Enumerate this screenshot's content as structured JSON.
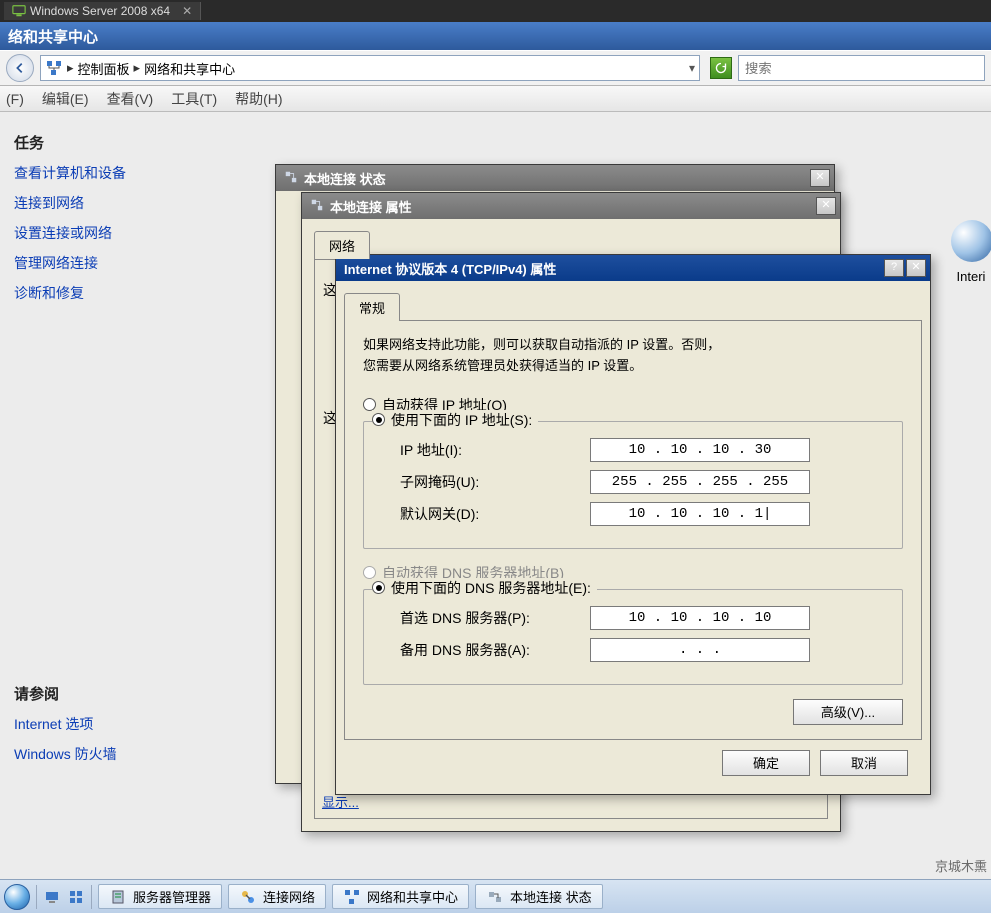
{
  "vm": {
    "tab_label": "Windows Server 2008 x64"
  },
  "window": {
    "title": "络和共享中心"
  },
  "addressbar": {
    "crumb1": "控制面板",
    "crumb2": "网络和共享中心",
    "search_placeholder": "搜索"
  },
  "menubar": {
    "file": "(F)",
    "edit": "编辑(E)",
    "view": "查看(V)",
    "tools": "工具(T)",
    "help": "帮助(H)"
  },
  "sidebar": {
    "tasks_header": "任务",
    "links": [
      "查看计算机和设备",
      "连接到网络",
      "设置连接或网络",
      "管理网络连接",
      "诊断和修复"
    ],
    "see_also_header": "请参阅",
    "see_also": [
      "Internet 选项",
      "Windows 防火墙"
    ]
  },
  "globe_label": "Interi",
  "dlg_status": {
    "title": "本地连接 状态"
  },
  "dlg_props": {
    "title": "本地连接 属性",
    "tab_network": "网络",
    "hint_char": "这",
    "link_show": "显示..."
  },
  "dlg_tcpip": {
    "title": "Internet 协议版本 4 (TCP/IPv4) 属性",
    "tab_general": "常规",
    "info_line1": "如果网络支持此功能，则可以获取自动指派的 IP 设置。否则，",
    "info_line2": "您需要从网络系统管理员处获得适当的 IP 设置。",
    "radio_auto_ip": "自动获得 IP 地址(O)",
    "radio_manual_ip": "使用下面的 IP 地址(S):",
    "label_ip": "IP 地址(I):",
    "label_mask": "子网掩码(U):",
    "label_gw": "默认网关(D):",
    "ip_value": "10 . 10 . 10 . 30",
    "mask_value": "255 . 255 . 255 . 255",
    "gw_value": "10 . 10 . 10 . 1|",
    "radio_auto_dns": "自动获得 DNS 服务器地址(B)",
    "radio_manual_dns": "使用下面的 DNS 服务器地址(E):",
    "label_dns1": "首选 DNS 服务器(P):",
    "label_dns2": "备用 DNS 服务器(A):",
    "dns1_value": "10 . 10 . 10 . 10",
    "dns2_value": ".       .       .",
    "btn_adv": "高级(V)...",
    "btn_ok": "确定",
    "btn_cancel": "取消"
  },
  "taskbar": {
    "items": [
      "服务器管理器",
      "连接网络",
      "网络和共享中心",
      "本地连接 状态"
    ],
    "watermark": "京城木熏"
  }
}
